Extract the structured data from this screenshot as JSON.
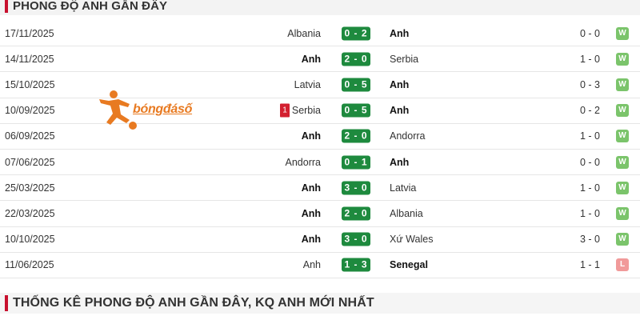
{
  "header_top": {
    "title": "PHONG ĐỘ ANH GẦN ĐÂY"
  },
  "header_bottom": {
    "title": "THỐNG KÊ PHONG ĐỘ ANH GẦN ĐÂY, KQ ANH MỚI NHẤT"
  },
  "watermark": {
    "text": "bóngđásố"
  },
  "colors": {
    "accent": "#c8102e",
    "score_bg": "#1e8a3e",
    "win": "#7bc46b",
    "loss": "#f19a9a"
  },
  "matches": [
    {
      "date": "17/11/2025",
      "home": "Albania",
      "score": "0 - 2",
      "away": "Anh",
      "ht": "0 - 0",
      "result": "W",
      "winner": "away",
      "red_card": ""
    },
    {
      "date": "14/11/2025",
      "home": "Anh",
      "score": "2 - 0",
      "away": "Serbia",
      "ht": "1 - 0",
      "result": "W",
      "winner": "home",
      "red_card": ""
    },
    {
      "date": "15/10/2025",
      "home": "Latvia",
      "score": "0 - 5",
      "away": "Anh",
      "ht": "0 - 3",
      "result": "W",
      "winner": "away",
      "red_card": ""
    },
    {
      "date": "10/09/2025",
      "home": "Serbia",
      "score": "0 - 5",
      "away": "Anh",
      "ht": "0 - 2",
      "result": "W",
      "winner": "away",
      "red_card": "1"
    },
    {
      "date": "06/09/2025",
      "home": "Anh",
      "score": "2 - 0",
      "away": "Andorra",
      "ht": "1 - 0",
      "result": "W",
      "winner": "home",
      "red_card": ""
    },
    {
      "date": "07/06/2025",
      "home": "Andorra",
      "score": "0 - 1",
      "away": "Anh",
      "ht": "0 - 0",
      "result": "W",
      "winner": "away",
      "red_card": ""
    },
    {
      "date": "25/03/2025",
      "home": "Anh",
      "score": "3 - 0",
      "away": "Latvia",
      "ht": "1 - 0",
      "result": "W",
      "winner": "home",
      "red_card": ""
    },
    {
      "date": "22/03/2025",
      "home": "Anh",
      "score": "2 - 0",
      "away": "Albania",
      "ht": "1 - 0",
      "result": "W",
      "winner": "home",
      "red_card": ""
    },
    {
      "date": "10/10/2025",
      "home": "Anh",
      "score": "3 - 0",
      "away": "Xứ Wales",
      "ht": "3 - 0",
      "result": "W",
      "winner": "home",
      "red_card": ""
    },
    {
      "date": "11/06/2025",
      "home": "Anh",
      "score": "1 - 3",
      "away": "Senegal",
      "ht": "1 - 1",
      "result": "L",
      "winner": "away",
      "red_card": ""
    }
  ]
}
